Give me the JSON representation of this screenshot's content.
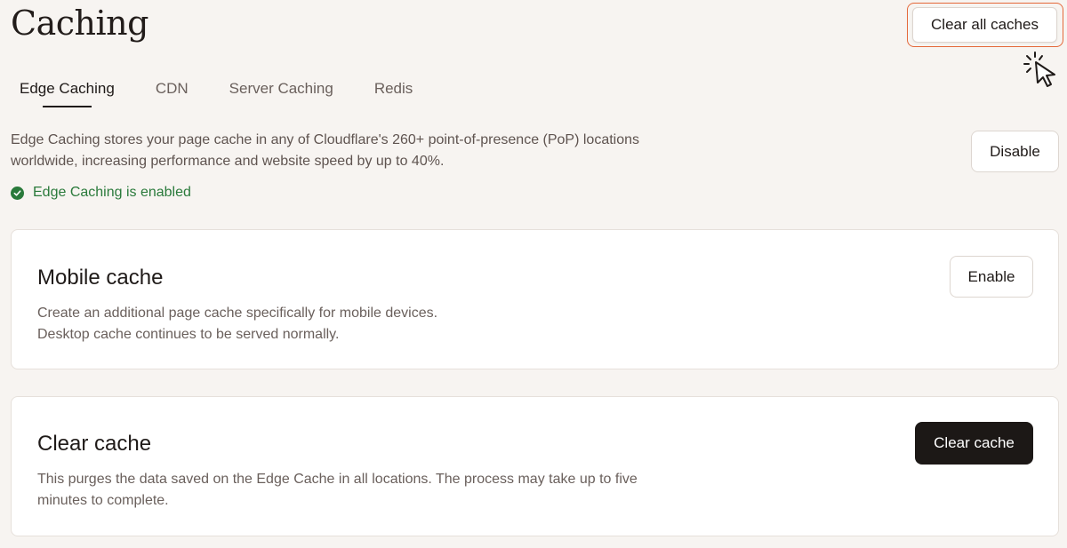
{
  "header": {
    "title": "Caching",
    "clear_all_label": "Clear all caches"
  },
  "tabs": [
    {
      "label": "Edge Caching",
      "active": true
    },
    {
      "label": "CDN",
      "active": false
    },
    {
      "label": "Server Caching",
      "active": false
    },
    {
      "label": "Redis",
      "active": false
    }
  ],
  "intro": {
    "line1": "Edge Caching stores your page cache in any of Cloudflare's 260+ point-of-presence (PoP) locations",
    "line2": "worldwide, increasing performance and website speed by up to 40%.",
    "disable_label": "Disable",
    "status_text": "Edge Caching is enabled"
  },
  "mobile_cache": {
    "title": "Mobile cache",
    "line1": "Create an additional page cache specifically for mobile devices.",
    "line2": "Desktop cache continues to be served normally.",
    "button_label": "Enable"
  },
  "clear_cache": {
    "title": "Clear cache",
    "line1": "This purges the data saved on the Edge Cache in all locations. The process may take up to five",
    "line2": "minutes to complete.",
    "button_label": "Clear cache"
  },
  "icons": {
    "status": "check-circle-icon",
    "cursor": "pointer-cursor-icon"
  },
  "colors": {
    "accent_outline": "#e4683a",
    "success": "#2a7a3b",
    "primary_button": "#1c1816",
    "background": "#f7f4f1"
  }
}
